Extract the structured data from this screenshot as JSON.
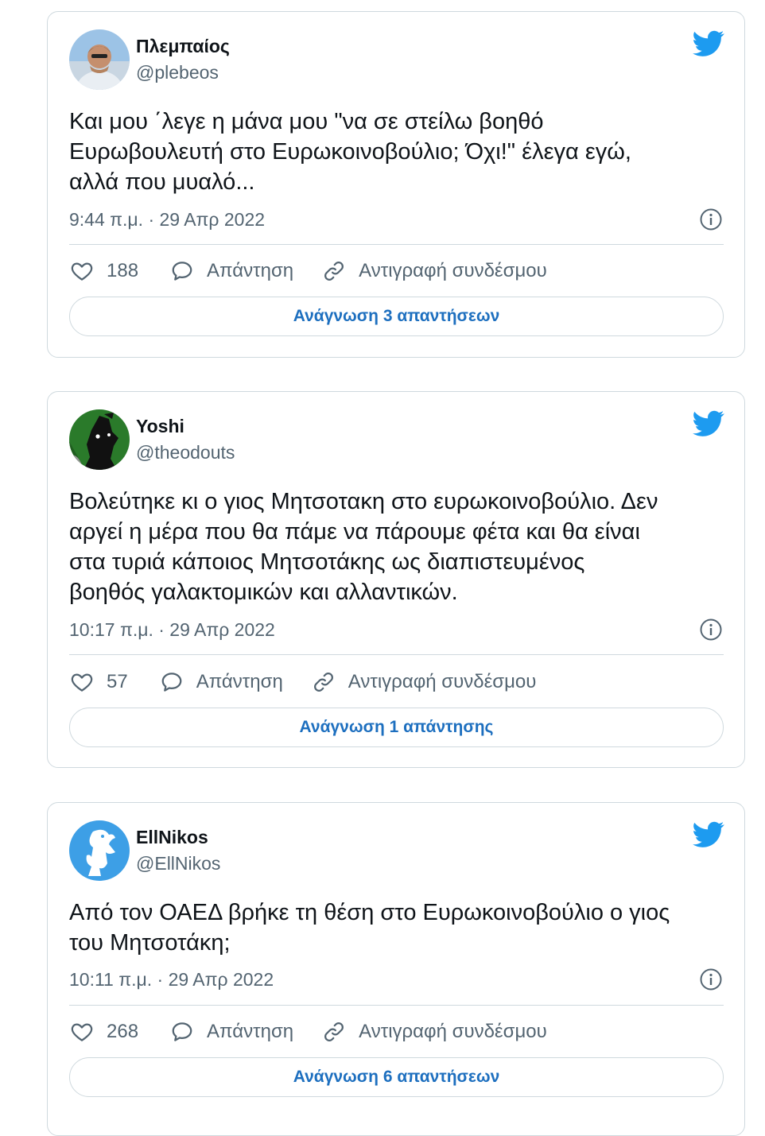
{
  "colors": {
    "twitter_blue": "#1d9bf0",
    "link_blue": "#1d6fbf",
    "secondary_text": "#536471",
    "border": "#cfd9de"
  },
  "tweets": [
    {
      "name": "Πλεμπαίος",
      "handle": "@plebeos",
      "text": "Και μου ΄λεγε η μάνα μου \"να σε στείλω βοηθό\nΕυρωβουλευτή στο Ευρωκοινοβούλιο; Όχι!\" έλεγα εγώ,\nαλλά που μυαλό...",
      "time": "9:44 π.μ. · 29 Απρ 2022",
      "likes": "188",
      "reply_label": "Απάντηση",
      "copy_label": "Αντιγραφή συνδέσμου",
      "read_more": "Ανάγνωση 3 απαντήσεων"
    },
    {
      "name": "Yoshi",
      "handle": "@theodouts",
      "text": "Βολεύτηκε κι ο γιος Μητσοτακη στο ευρωκοινοβούλιο. Δεν\nαργεί η μέρα που θα πάμε να πάρουμε φέτα και θα είναι\nστα τυριά κάποιος Μητσοτάκης ως διαπιστευμένος\nβοηθός γαλακτομικών και αλλαντικών.",
      "time": "10:17 π.μ. · 29 Απρ 2022",
      "likes": "57",
      "reply_label": "Απάντηση",
      "copy_label": "Αντιγραφή συνδέσμου",
      "read_more": "Ανάγνωση 1 απάντησης"
    },
    {
      "name": "EllNikos",
      "handle": "@EllNikos",
      "text": "Από τον ΟΑΕΔ βρήκε τη θέση στο Ευρωκοινοβούλιο ο γιος\nτου Μητσοτάκη;",
      "time": "10:11 π.μ. · 29 Απρ 2022",
      "likes": "268",
      "reply_label": "Απάντηση",
      "copy_label": "Αντιγραφή συνδέσμου",
      "read_more": "Ανάγνωση 6 απαντήσεων"
    }
  ]
}
